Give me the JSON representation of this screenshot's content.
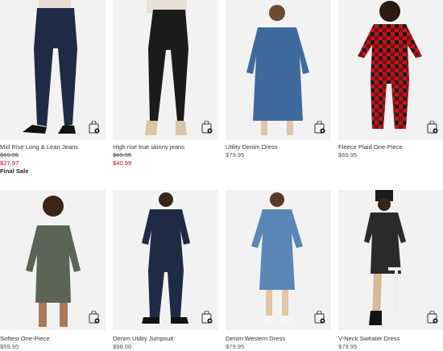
{
  "products": [
    {
      "name": "Mid Rise Long & Lean Jeans",
      "orig_price": "$69.95",
      "sale_price": "$27.97",
      "note": "Final Sale",
      "icon": "quick-add-bag-icon"
    },
    {
      "name": "High rise true skinny jeans",
      "orig_price": "$69.95",
      "sale_price": "$40.99",
      "icon": "quick-add-bag-icon"
    },
    {
      "name": "Utility Denim Dress",
      "price": "$79.95",
      "icon": "quick-add-bag-icon"
    },
    {
      "name": "Fleece Plaid One-Piece",
      "price": "$69.95",
      "icon": "quick-add-bag-icon"
    },
    {
      "name": "Softest One-Piece",
      "price": "$59.95",
      "icon": "quick-add-bag-icon"
    },
    {
      "name": "Denim Utility Jumpsuit",
      "price": "$98.00",
      "icon": "quick-add-bag-icon"
    },
    {
      "name": "Denim Western Dress",
      "price": "$79.95",
      "icon": "quick-add-bag-icon"
    },
    {
      "name": "V-Neck Sweater Dress",
      "price": "$79.95",
      "icon": "quick-add-bag-icon"
    }
  ],
  "colors": {
    "sale": "#d0021b",
    "image_bg": "#f2f2f2",
    "denim_dark": "#1f2a44",
    "denim_mid": "#3f6a9e",
    "black": "#1b1b1b",
    "plaid_red": "#c0141c",
    "olive": "#5c6357"
  }
}
